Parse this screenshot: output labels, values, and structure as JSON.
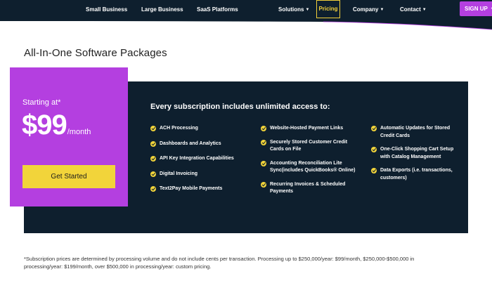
{
  "nav": {
    "small_business": "Small Business",
    "large_business": "Large Business",
    "saas_platforms": "SaaS Platforms",
    "solutions": "Solutions",
    "pricing": "Pricing",
    "company": "Company",
    "contact": "Contact",
    "signup": "SIGN UP"
  },
  "page": {
    "title": "All-In-One Software Packages"
  },
  "card": {
    "starting_at": "Starting at*",
    "price": "$99",
    "period": "/month",
    "cta": "Get Started"
  },
  "features": {
    "heading": "Every subscription includes unlimited access to:",
    "col1": [
      "ACH Processing",
      "Dashboards and Analytics",
      "API Key Integration Capabilities",
      "Digital Invoicing",
      "Text2Pay Mobile Payments"
    ],
    "col2": [
      "Website-Hosted Payment Links",
      "Securely Stored Customer Credit Cards on File",
      "Accounting Reconciliation Lite Sync(includes QuickBooks® Online)",
      "Recurring Invoices & Scheduled Payments"
    ],
    "col3": [
      "Automatic Updates for Stored Credit Cards",
      "One-Click Shopping Cart Setup with Catalog Management",
      "Data Exports (i.e. transactions, customers)"
    ]
  },
  "footnote": "*Subscription prices are determined by processing volume and do not include cents per transaction. Processing up to $250,000/year: $99/month, $250,000-$500,000 in processing/year: $199/month, over $500,000 in processing/year: custom pricing.",
  "colors": {
    "navy": "#0e1f2e",
    "purple": "#b43fe0",
    "yellow": "#f2d43a"
  },
  "icons": {
    "check": "check-circle-icon",
    "caret": "caret-down-icon",
    "arrow": "arrow-up-icon"
  }
}
